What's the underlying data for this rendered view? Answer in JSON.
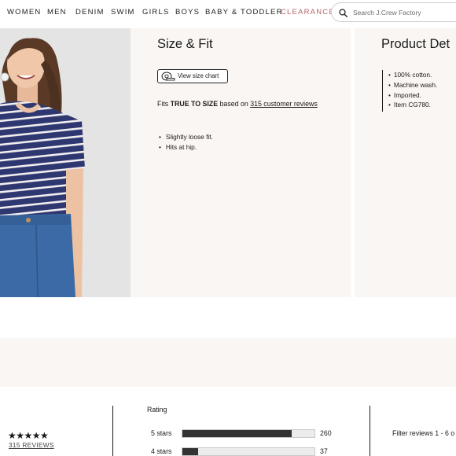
{
  "nav": {
    "items": [
      "WOMEN",
      "MEN",
      "DENIM",
      "SWIM",
      "GIRLS",
      "BOYS",
      "BABY & TODDLER",
      "CLEARANCE"
    ],
    "search_placeholder": "Search J.Crew Factory"
  },
  "size_fit": {
    "title": "Size & Fit",
    "size_chart_label": "View size chart",
    "fit_prefix": "Fits",
    "fit_value": "TRUE TO SIZE",
    "fit_middle": "based on",
    "fit_link": "315 customer reviews",
    "bullets": [
      "Slightly loose fit.",
      "Hits at hip."
    ]
  },
  "product_details": {
    "title": "Product Det",
    "bullets": [
      "100% cotton.",
      "Machine wash.",
      "Imported.",
      "Item CG780."
    ]
  },
  "reviews": {
    "stars": "★★★★★",
    "rating_value": 5,
    "count_label": "315 REVIEWS",
    "rating_title": "Rating",
    "rows": [
      {
        "label": "5 stars",
        "count": "260",
        "fraction": 0.83
      },
      {
        "label": "4 stars",
        "count": "37",
        "fraction": 0.12
      }
    ],
    "filter_text": "Filter reviews 1 - 6 o"
  },
  "colors": {
    "panel_bg": "#faf6f3",
    "clearance": "#b5656a",
    "bar_fill": "#333333",
    "bar_bg": "#ececec"
  }
}
